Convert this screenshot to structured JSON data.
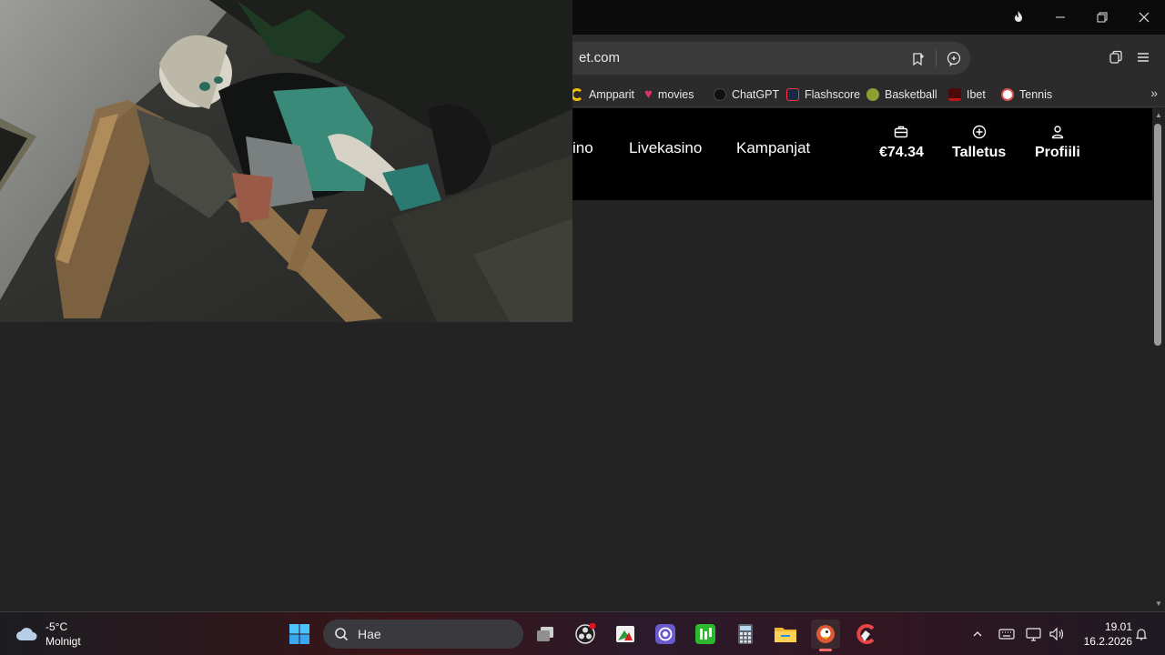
{
  "browser": {
    "url_text": "et.com",
    "bookmarks": [
      {
        "label": "Ampparit",
        "icon": "ampparit-icon",
        "color": "#f2c000"
      },
      {
        "label": "movies",
        "icon": "heart-icon",
        "color": "#e0306a"
      },
      {
        "label": "ChatGPT",
        "icon": "chatgpt-icon",
        "color": "#1a1a1a"
      },
      {
        "label": "Flashscore",
        "icon": "flashscore-icon",
        "color": "#1a2a40"
      },
      {
        "label": "Basketball",
        "icon": "basketball-icon",
        "color": "#8aa030"
      },
      {
        "label": "Ibet",
        "icon": "ibet-icon",
        "color": "#c01818"
      },
      {
        "label": "Tennis",
        "icon": "tennis-icon",
        "color": "#e05050"
      }
    ]
  },
  "site": {
    "nav": {
      "partial_link": "ino",
      "livekasino": "Livekasino",
      "kampanjat": "Kampanjat"
    },
    "balance": "€74.34",
    "deposit": "Talletus",
    "profile": "Profiili"
  },
  "taskbar": {
    "weather_temp": "-5°C",
    "weather_desc": "Molnigt",
    "search_placeholder": "Hae",
    "time": "19.01",
    "date": "16.2.2026"
  }
}
